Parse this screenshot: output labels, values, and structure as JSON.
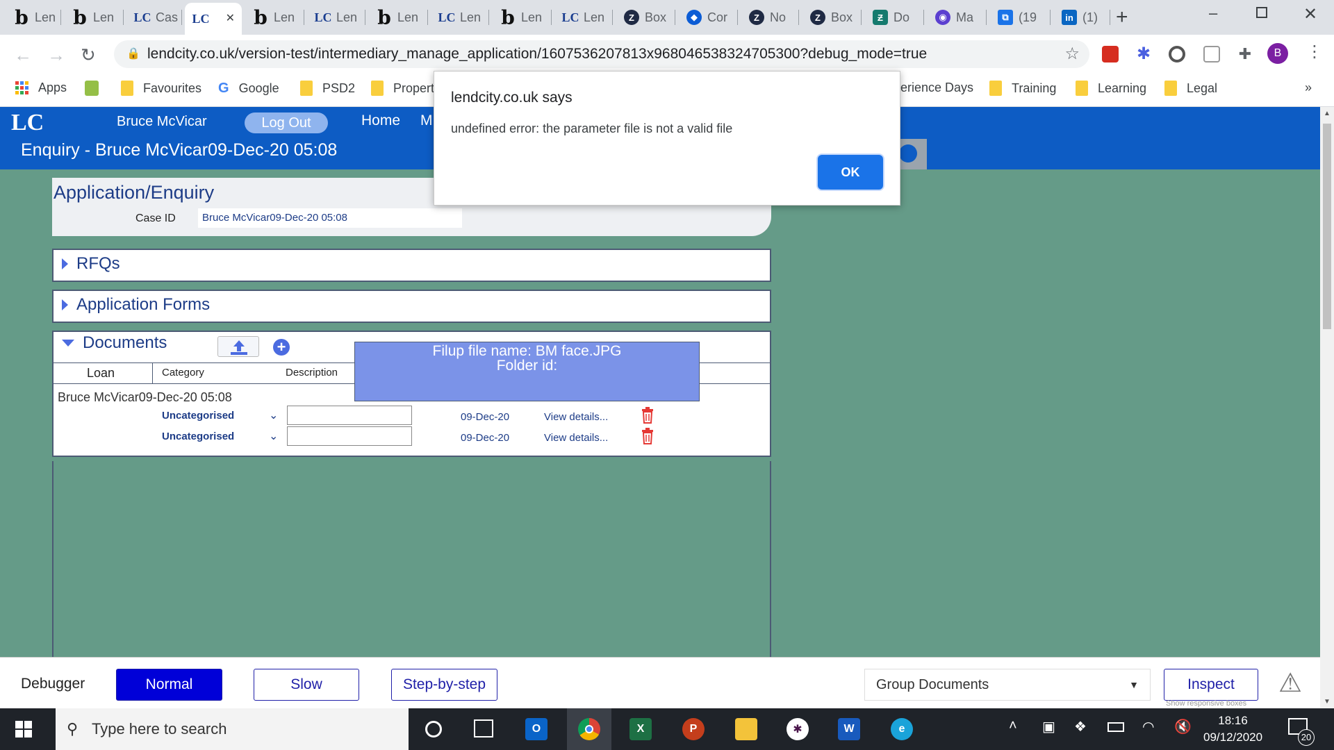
{
  "browser": {
    "tabs": [
      {
        "label": "Len",
        "icon": "b"
      },
      {
        "label": "Len",
        "icon": "b"
      },
      {
        "label": "Cas",
        "icon": "LC"
      },
      {
        "label": "",
        "icon": "LC",
        "active": true
      },
      {
        "label": "Len",
        "icon": "b"
      },
      {
        "label": "Len",
        "icon": "LC"
      },
      {
        "label": "Len",
        "icon": "b"
      },
      {
        "label": "Len",
        "icon": "LC"
      },
      {
        "label": "Len",
        "icon": "b"
      },
      {
        "label": "Len",
        "icon": "LC"
      },
      {
        "label": "Box",
        "icon": "box"
      },
      {
        "label": "Cor",
        "icon": "con"
      },
      {
        "label": "No",
        "icon": "box"
      },
      {
        "label": "Box",
        "icon": "box"
      },
      {
        "label": "Do",
        "icon": "do"
      },
      {
        "label": "Ma",
        "icon": "ma"
      },
      {
        "label": "(19",
        "icon": "19"
      },
      {
        "label": "(1)",
        "icon": "in"
      }
    ],
    "url": "lendcity.co.uk/version-test/intermediary_manage_application/1607536207813x968046538324705300?debug_mode=true",
    "profile_initial": "B",
    "bookmarks": [
      "Apps",
      "Favourites",
      "Google",
      "PSD2",
      "Propert",
      "erience Days",
      "Training",
      "Learning",
      "Legal"
    ],
    "overflow": "»"
  },
  "app": {
    "logo": "LC",
    "user": "Bruce McVicar",
    "logout": "Log Out",
    "nav_home": "Home",
    "nav_m": "M",
    "title": "Enquiry -  Bruce McVicar09-Dec-20 05:08",
    "app_panel": {
      "title": "Application/Enquiry",
      "case_label": "Case ID",
      "case_value": "Bruce McVicar09-Dec-20 05:08"
    },
    "rfqs": "RFQs",
    "forms": "Application Forms",
    "documents": {
      "title": "Documents",
      "columns": [
        "Loan",
        "Category",
        "Description"
      ],
      "loan_name": "Bruce McVicar09-Dec-20 05:08",
      "rows": [
        {
          "category": "Uncategorised",
          "date": "09-Dec-20",
          "link": "View details..."
        },
        {
          "category": "Uncategorised",
          "date": "09-Dec-20",
          "link": "View details..."
        }
      ],
      "filup_line1": "Filup file name: BM face.JPG",
      "filup_line2": "Folder id:"
    }
  },
  "dialog": {
    "title": "lendcity.co.uk says",
    "message": "undefined error: the parameter file is not a valid file",
    "ok": "OK"
  },
  "debugger": {
    "label": "Debugger",
    "normal": "Normal",
    "slow": "Slow",
    "step": "Step-by-step",
    "select_value": "Group Documents",
    "inspect": "Inspect",
    "responsive": "Show responsive boxes"
  },
  "taskbar": {
    "search_placeholder": "Type here to search",
    "time": "18:16",
    "date": "09/12/2020",
    "notifications": "20"
  }
}
